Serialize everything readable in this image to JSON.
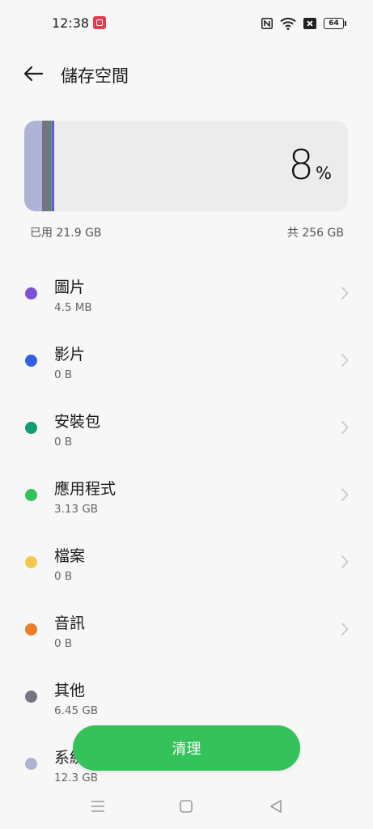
{
  "status_bar": {
    "time": "12:38",
    "icons": [
      "notification-app-icon",
      "nfc-icon",
      "wifi-icon",
      "close-box-icon",
      "battery-icon"
    ],
    "battery_level": "64"
  },
  "header": {
    "title": "儲存空間",
    "back_icon": "arrow-left-icon"
  },
  "storage": {
    "percent": "8",
    "percent_sign": "%",
    "used_label": "已用 21.9 GB",
    "total_label": "共 256 GB"
  },
  "categories": [
    {
      "name": "圖片",
      "size": "4.5 MB",
      "color": "#7c53d6"
    },
    {
      "name": "影片",
      "size": "0 B",
      "color": "#3560e6"
    },
    {
      "name": "安裝包",
      "size": "0 B",
      "color": "#129e74"
    },
    {
      "name": "應用程式",
      "size": "3.13  GB",
      "color": "#36c25a"
    },
    {
      "name": "檔案",
      "size": "0 B",
      "color": "#f5c84c"
    },
    {
      "name": "音訊",
      "size": "0 B",
      "color": "#ea7d29"
    },
    {
      "name": "其他",
      "size": "6.45 GB",
      "color": "#727584"
    },
    {
      "name": "系統",
      "size": "12.3 GB",
      "color": "#adb4d3"
    }
  ],
  "actions": {
    "clean_label": "清理"
  },
  "nav": {
    "icons": [
      "menu-icon",
      "home-icon",
      "back-icon"
    ]
  }
}
